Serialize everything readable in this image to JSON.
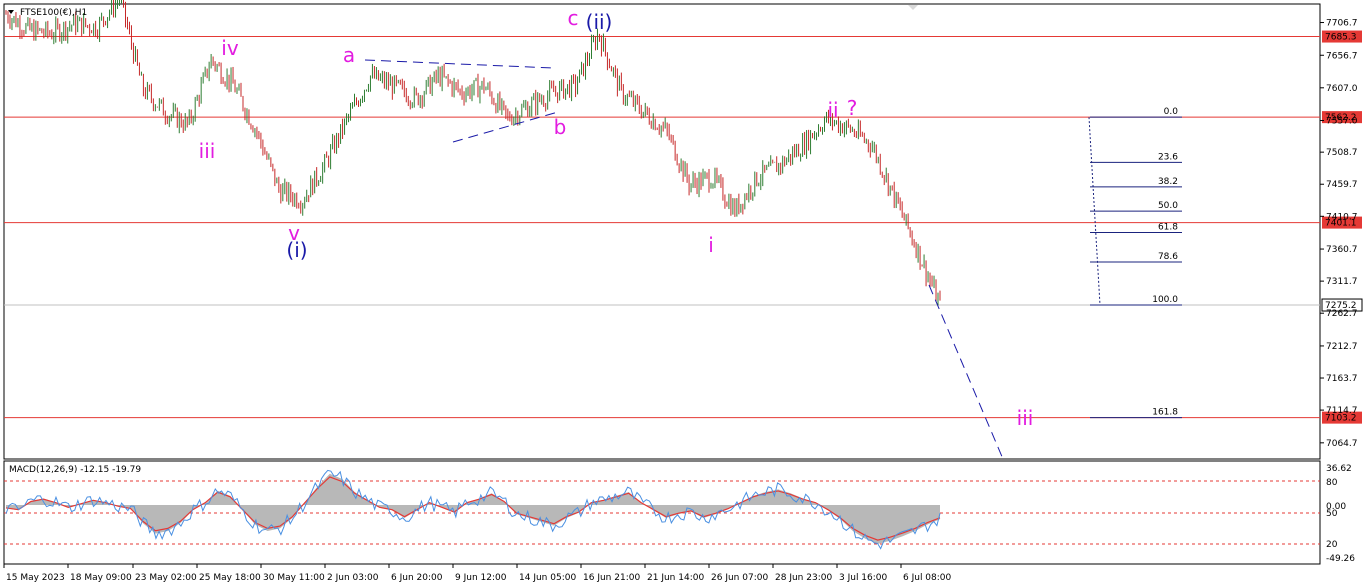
{
  "window": {
    "symbol_label": "FTSE100(€),H1",
    "indicator_label": "MACD(12,26,9) -12.15 -19.79"
  },
  "colors": {
    "bull": "#2e7d32",
    "bear": "#c62828",
    "level_line": "#e53935",
    "wave_magenta": "#e21ce0",
    "wave_blue": "#1a1aa8",
    "fib": "#1a237e",
    "macd_hist": "#b8b8b8",
    "macd_signal": "#e53935",
    "macd_main": "#4a90e2"
  },
  "chart_data": [
    {
      "type": "line",
      "title": "FTSE100(€),H1",
      "series": [],
      "points": [
        [
          "15 May 2023",
          7720
        ],
        [
          "16 May",
          7695
        ],
        [
          "17 May",
          7690
        ],
        [
          "18 May 09:00",
          7705
        ],
        [
          "19 May",
          7700
        ],
        [
          "22 May",
          7745
        ],
        [
          "23 May 02:00",
          7605
        ],
        [
          "24 May",
          7570
        ],
        [
          "25 May",
          7550
        ],
        [
          "25 May 18:00",
          7650
        ],
        [
          "26 May",
          7610
        ],
        [
          "29 May",
          7540
        ],
        [
          "30 May 04:00",
          7450
        ],
        [
          "30 May 11:00",
          7435
        ],
        [
          "31 May",
          7490
        ],
        [
          "1 Jun",
          7560
        ],
        [
          "2 Jun 03:00",
          7625
        ],
        [
          "2 Jun 16:00",
          7610
        ],
        [
          "5 Jun",
          7590
        ],
        [
          "6 Jun 20:00",
          7625
        ],
        [
          "7 Jun",
          7600
        ],
        [
          "8 Jun",
          7610
        ],
        [
          "9 Jun 12:00",
          7560
        ],
        [
          "12 Jun",
          7580
        ],
        [
          "13 Jun",
          7600
        ],
        [
          "14 Jun 05:00",
          7610
        ],
        [
          "15 Jun",
          7690
        ],
        [
          "16 Jun 21:00",
          7600
        ],
        [
          "19 Jun",
          7570
        ],
        [
          "20 Jun",
          7540
        ],
        [
          "21 Jun 14:00",
          7460
        ],
        [
          "22 Jun",
          7470
        ],
        [
          "23 Jun",
          7420
        ],
        [
          "26 Jun 07:00",
          7470
        ],
        [
          "27 Jun",
          7490
        ],
        [
          "28 Jun 23:00",
          7520
        ],
        [
          "29 Jun",
          7560
        ],
        [
          "30 Jun",
          7545
        ],
        [
          "3 Jul 16:00",
          7520
        ],
        [
          "4 Jul",
          7440
        ],
        [
          "5 Jul",
          7360
        ],
        [
          "6 Jul 08:00",
          7275
        ]
      ],
      "y_ticks": [
        "7706.7",
        "7656.7",
        "7607.0",
        "7557.0",
        "7508.7",
        "7459.7",
        "7410.7",
        "7360.7",
        "7311.7",
        "7262.7",
        "7212.7",
        "7163.7",
        "7114.7",
        "7064.7"
      ],
      "x_ticks": [
        "15 May 2023",
        "18 May 09:00",
        "23 May 02:00",
        "25 May 18:00",
        "30 May 11:00",
        "2 Jun 03:00",
        "6 Jun 20:00",
        "9 Jun 12:00",
        "14 Jun 05:00",
        "16 Jun 21:00",
        "21 Jun 14:00",
        "26 Jun 07:00",
        "28 Jun 23:00",
        "3 Jul 16:00",
        "6 Jul 08:00"
      ],
      "ylim": [
        7040,
        7735
      ],
      "current_price": "7275.2",
      "levels": [
        {
          "label": "7685.3",
          "value": 7685.3
        },
        {
          "label": "7562.2",
          "value": 7562.2
        },
        {
          "label": "7401.1",
          "value": 7401.1
        },
        {
          "label": "7103.2",
          "value": 7103.2
        }
      ],
      "fib_levels": [
        {
          "label": "0.0",
          "value": 7562.2
        },
        {
          "label": "23.6",
          "value": 7493.0
        },
        {
          "label": "38.2",
          "value": 7455.6
        },
        {
          "label": "50.0",
          "value": 7418.6
        },
        {
          "label": "61.8",
          "value": 7386.0
        },
        {
          "label": "78.6",
          "value": 7341.0
        },
        {
          "label": "100.0",
          "value": 7275.2
        },
        {
          "label": "161.8",
          "value": 7103.2
        }
      ],
      "wave_labels": [
        {
          "text": "c",
          "color": "magenta"
        },
        {
          "text": "(ii)",
          "color": "blue"
        },
        {
          "text": "iv",
          "color": "magenta"
        },
        {
          "text": "a",
          "color": "magenta"
        },
        {
          "text": "ii",
          "color": "magenta"
        },
        {
          "text": "?",
          "color": "magenta"
        },
        {
          "text": "iii",
          "color": "magenta"
        },
        {
          "text": "b",
          "color": "magenta"
        },
        {
          "text": "v",
          "color": "magenta"
        },
        {
          "text": "(i)",
          "color": "blue"
        },
        {
          "text": "i",
          "color": "magenta"
        },
        {
          "text": "iii",
          "color": "magenta"
        }
      ]
    },
    {
      "type": "line",
      "title": "MACD(12,26,9) -12.15 -19.79",
      "y_ticks": [
        "36.62",
        "80",
        "50",
        "0.00",
        "20",
        "-49.26"
      ],
      "histogram": [
        -5,
        -8,
        6,
        10,
        4,
        -4,
        2,
        8,
        4,
        -2,
        -6,
        -28,
        -44,
        -40,
        -28,
        -8,
        4,
        22,
        14,
        -8,
        -30,
        -40,
        -36,
        -20,
        4,
        28,
        48,
        40,
        20,
        8,
        -4,
        -8,
        -20,
        -8,
        4,
        -4,
        -12,
        4,
        10,
        18,
        6,
        -14,
        -20,
        -26,
        -32,
        -20,
        -12,
        4,
        8,
        14,
        20,
        4,
        -8,
        -20,
        -14,
        -10,
        -20,
        -14,
        -6,
        4,
        14,
        20,
        24,
        18,
        10,
        4,
        -8,
        -22,
        -40,
        -52,
        -60,
        -55,
        -48,
        -40,
        -30,
        -22
      ]
    }
  ]
}
